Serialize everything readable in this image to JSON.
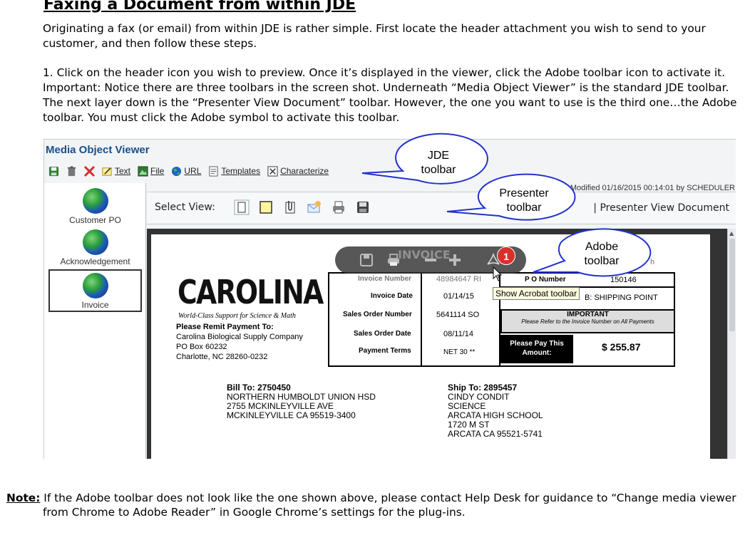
{
  "doc": {
    "title": "Faxing a Document from within JDE",
    "para1": "Originating a fax (or email) from within JDE is rather simple.  First locate the header attachment you wish to send to your customer, and then follow these steps.",
    "para2": "1. Click on the header icon you wish to preview.  Once it’s displayed in the viewer, click the Adobe toolbar icon to activate it.  Important: Notice there are three toolbars in the screen shot.  Underneath “Media Object Viewer” is the standard JDE toolbar.  The next layer down is the “Presenter View Document” toolbar.  However, the one you want to use is the third one…the Adobe toolbar.  You must click the Adobe symbol to activate this toolbar.",
    "note_label": "Note:",
    "note_text": " If the Adobe toolbar does not look like the one shown above, please contact Help Desk for guidance to “Change media viewer from Chrome to Adobe Reader” in Google Chrome’s settings for the plug-ins."
  },
  "viewer": {
    "title": "Media Object Viewer",
    "toolbar": {
      "text": "Text",
      "file": "File",
      "url": "URL",
      "templates": "Templates",
      "characterize": "Characterize"
    },
    "attachments": [
      "Customer PO",
      "Acknowledgement",
      "Invoice"
    ],
    "last_modified": "ast Modified 01/16/2015 00:14:01 by SCHEDULER",
    "select_view": "Select View:",
    "presenter_title": "| Presenter View Document",
    "tooltip": "Show Acrobat toolbar",
    "badge": "1"
  },
  "callouts": {
    "jde": "JDE\ntoolbar",
    "presenter": "Presenter\ntoolbar",
    "adobe": "Adobe\ntoolbar"
  },
  "invoice": {
    "ghost_title": "INVOICE",
    "logo": "CAROLINA",
    "tagline": "World-Class Support for Science & Math",
    "remit_heading": "Please Remit Payment To:",
    "remit_lines": [
      "Carolina Biological Supply Company",
      "PO Box 60232",
      "Charlotte, NC  28260-0232"
    ],
    "fields": {
      "invoice_number_label": "Invoice Number",
      "invoice_number": "48984647 RI",
      "invoice_date_label": "Invoice Date",
      "invoice_date": "01/14/15",
      "sales_order_number_label": "Sales Order Number",
      "sales_order_number": "5641114 SO",
      "sales_order_date_label": "Sales Order Date",
      "sales_order_date": "08/11/14",
      "payment_terms_label": "Payment Terms",
      "payment_terms": "NET 30 **",
      "po_number_label": "P O Number",
      "po_number": "150146",
      "fob": "B: SHIPPING POINT",
      "page_label": "h"
    },
    "important_title": "IMPORTANT",
    "important_sub": "Please Refer to the Invoice Number on All Payments",
    "pay_label": "Please Pay This Amount:",
    "amount": "$ 255.87",
    "bill_to": [
      "Bill To:  2750450",
      "NORTHERN HUMBOLDT UNION HSD",
      "2755 MCKINLEYVILLE AVE",
      "MCKINLEYVILLE CA 95519-3400"
    ],
    "ship_to": [
      "Ship To: 2895457",
      "CINDY CONDIT",
      "SCIENCE",
      "ARCATA HIGH SCHOOL",
      "1720 M ST",
      "ARCATA CA 95521-5741"
    ]
  },
  "colors": {
    "viewer_title": "#1b4f86",
    "callout_stroke": "#2233cc",
    "badge": "#d9302c"
  }
}
